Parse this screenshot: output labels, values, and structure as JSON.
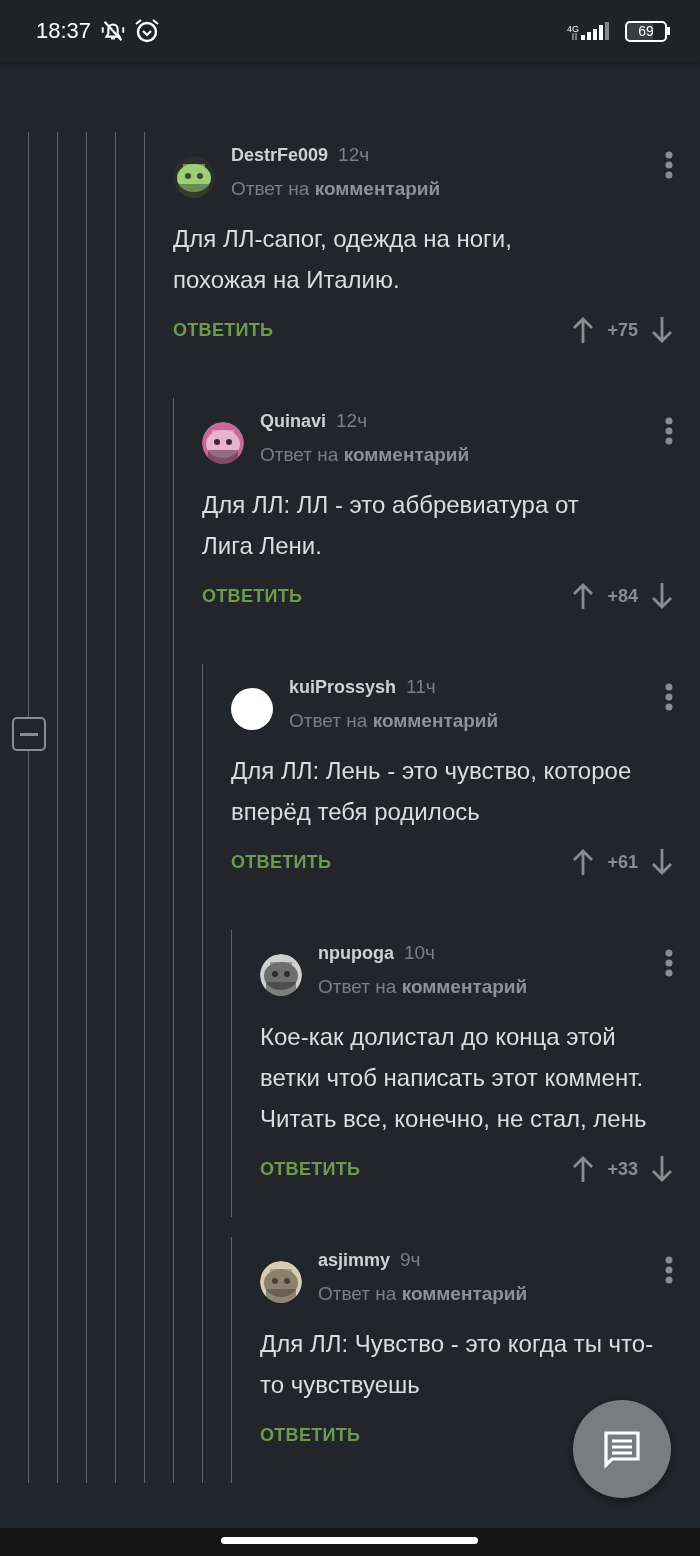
{
  "status_bar": {
    "time": "18:37",
    "network": "4G",
    "battery": "69"
  },
  "comments": [
    {
      "author": "DestrFe009",
      "time": "12ч",
      "reply_prefix": "Ответ на",
      "reply_target": "комментарий",
      "avatar": {
        "kind": "picture"
      },
      "text": "Для ЛЛ-сапог, одежда на ноги, похожая на Италию.",
      "reply_label": "ОТВЕТИТЬ",
      "score": "+75",
      "children": [
        {
          "author": "Quinavi",
          "time": "12ч",
          "reply_prefix": "Ответ на",
          "reply_target": "комментарий",
          "avatar": {
            "kind": "picture"
          },
          "text": "Для ЛЛ: ЛЛ - это аббревиатура от Лига Лени.",
          "reply_label": "ОТВЕТИТЬ",
          "score": "+84",
          "children": [
            {
              "author": "kuiProssysh",
              "time": "11ч",
              "reply_prefix": "Ответ на",
              "reply_target": "комментарий",
              "avatar": {
                "kind": "blank"
              },
              "text": "Для ЛЛ: Лень - это чувство, которое вперёд тебя родилось",
              "reply_label": "ОТВЕТИТЬ",
              "score": "+61",
              "children": [
                {
                  "author": "npupoga",
                  "time": "10ч",
                  "reply_prefix": "Ответ на",
                  "reply_target": "комментарий",
                  "avatar": {
                    "kind": "picture"
                  },
                  "text": "Кое-как долистал до конца этой ветки чтоб написать этот коммент. Читать все, конечно, не стал, лень",
                  "reply_label": "ОТВЕТИТЬ",
                  "score": "+33"
                },
                {
                  "author": "asjimmy",
                  "time": "9ч",
                  "reply_prefix": "Ответ на",
                  "reply_target": "комментарий",
                  "avatar": {
                    "kind": "picture"
                  },
                  "text": "Для ЛЛ: Чувство - это когда ты что-то чувствуешь",
                  "reply_label": "ОТВЕТИТЬ"
                }
              ]
            }
          ]
        }
      ]
    }
  ]
}
